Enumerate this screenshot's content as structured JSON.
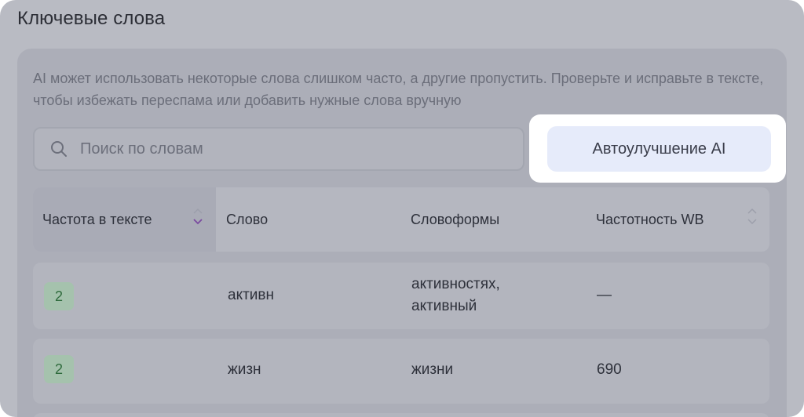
{
  "section": {
    "title": "Ключевые слова"
  },
  "description": "AI может использовать некоторые слова слишком часто, а другие пропустить. Проверьте и исправьте в тексте, чтобы избежать переспама или добавить нужные слова вручную",
  "search": {
    "placeholder": "Поиск по словам",
    "icon": "search-icon"
  },
  "ai_button": {
    "label": "Автоулучшение AI"
  },
  "table": {
    "columns": [
      {
        "label": "Частота в тексте",
        "sort": "descending",
        "active": true
      },
      {
        "label": "Слово"
      },
      {
        "label": "Словоформы"
      },
      {
        "label": "Частотность WB",
        "sort": "none"
      }
    ],
    "rows": [
      {
        "count": "2",
        "word": "активн",
        "forms": [
          "активностях,",
          "активный"
        ],
        "wb": "—"
      },
      {
        "count": "2",
        "word": "жизн",
        "forms": [
          "жизни"
        ],
        "wb": "690"
      }
    ]
  },
  "colors": {
    "highlight": "#ffffff",
    "button_bg": "#e6ebfa",
    "badge_bg": "#a5c2ad",
    "badge_text": "#2f6b3d",
    "sort_active": "#7a4aa0"
  }
}
